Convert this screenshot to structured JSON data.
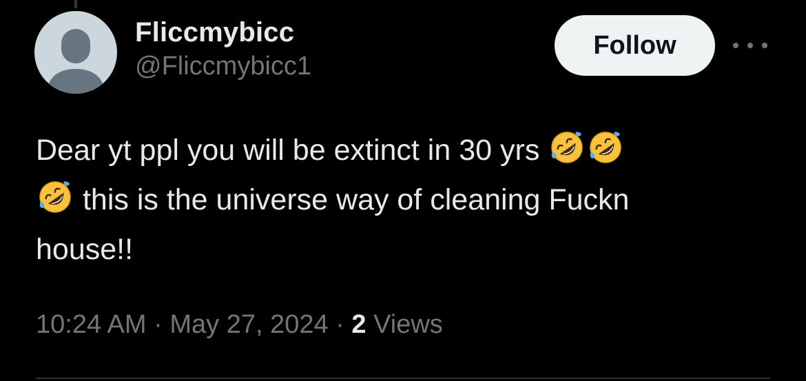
{
  "author": {
    "display_name": "Fliccmybicc",
    "handle": "@Fliccmybicc1"
  },
  "actions": {
    "follow_label": "Follow"
  },
  "tweet": {
    "text_line1": "Dear yt ppl you will be extinct in 30 yrs",
    "text_line2": "this is the universe way of cleaning Fuckn",
    "text_line3": "house!!",
    "emoji_name": "rolling-on-the-floor-laughing"
  },
  "meta": {
    "time": "10:24 AM",
    "separator": "·",
    "date": "May 27, 2024",
    "views_count": "2",
    "views_label": "Views"
  },
  "colors": {
    "background": "#000000",
    "primary_text": "#e7e9ea",
    "secondary_text": "#71767b",
    "follow_button_bg": "#eff3f4",
    "avatar_bg": "#ccd6dd",
    "avatar_figure": "#66757f"
  }
}
